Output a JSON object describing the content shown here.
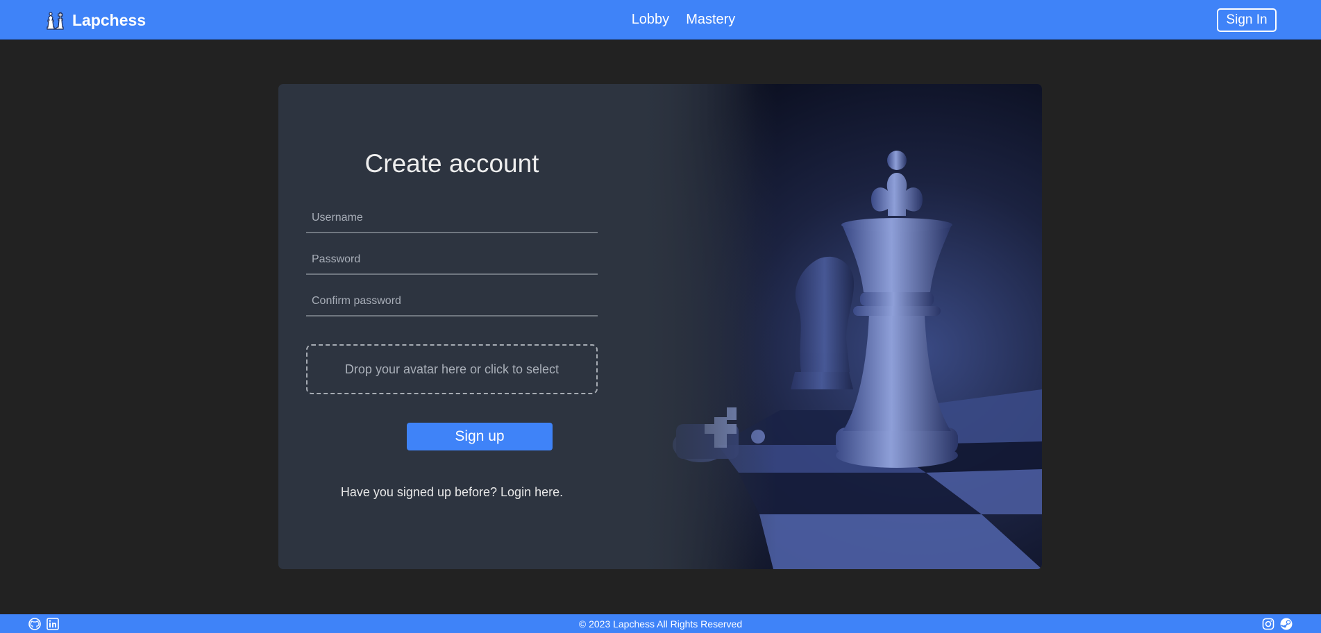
{
  "header": {
    "brand_name": "Lapchess",
    "nav": [
      {
        "label": "Lobby"
      },
      {
        "label": "Mastery"
      }
    ],
    "signin_label": "Sign In"
  },
  "form": {
    "title": "Create account",
    "username_placeholder": "Username",
    "password_placeholder": "Password",
    "confirm_placeholder": "Confirm password",
    "dropzone_text": "Drop your avatar here or click to select",
    "submit_label": "Sign up",
    "login_hint": "Have you signed up before? Login here."
  },
  "footer": {
    "copyright": "© 2023 Lapchess All Rights Reserved",
    "icons_left": [
      "github-icon",
      "linkedin-icon"
    ],
    "icons_right": [
      "instagram-icon",
      "steam-icon"
    ]
  },
  "colors": {
    "accent": "#3f83f8",
    "page_bg": "#222222",
    "card_bg": "#2d3440"
  }
}
